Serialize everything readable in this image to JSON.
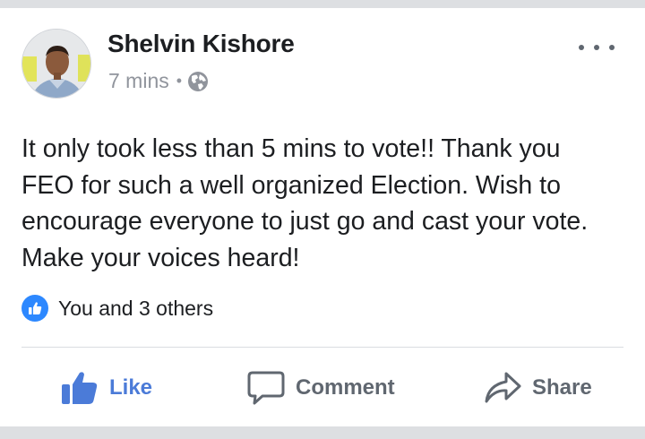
{
  "post": {
    "author": "Shelvin Kishore",
    "time": "7 mins",
    "separator": "•",
    "privacy_icon": "globe-icon",
    "menu_icon": "more-options-icon",
    "text": "It only took less than 5 mins to vote!! Thank you FEO for such a well organized Election. Wish to encourage everyone to just go and cast your vote. Make your voices heard!"
  },
  "reactions": {
    "icon": "like-icon",
    "summary": "You and 3 others"
  },
  "actions": {
    "like_label": "Like",
    "comment_label": "Comment",
    "share_label": "Share"
  },
  "colors": {
    "like_active": "#4b7bd8",
    "like_badge": "#2d88ff",
    "muted_text": "#90949c",
    "action_text": "#606770",
    "background": "#dddfe2"
  }
}
